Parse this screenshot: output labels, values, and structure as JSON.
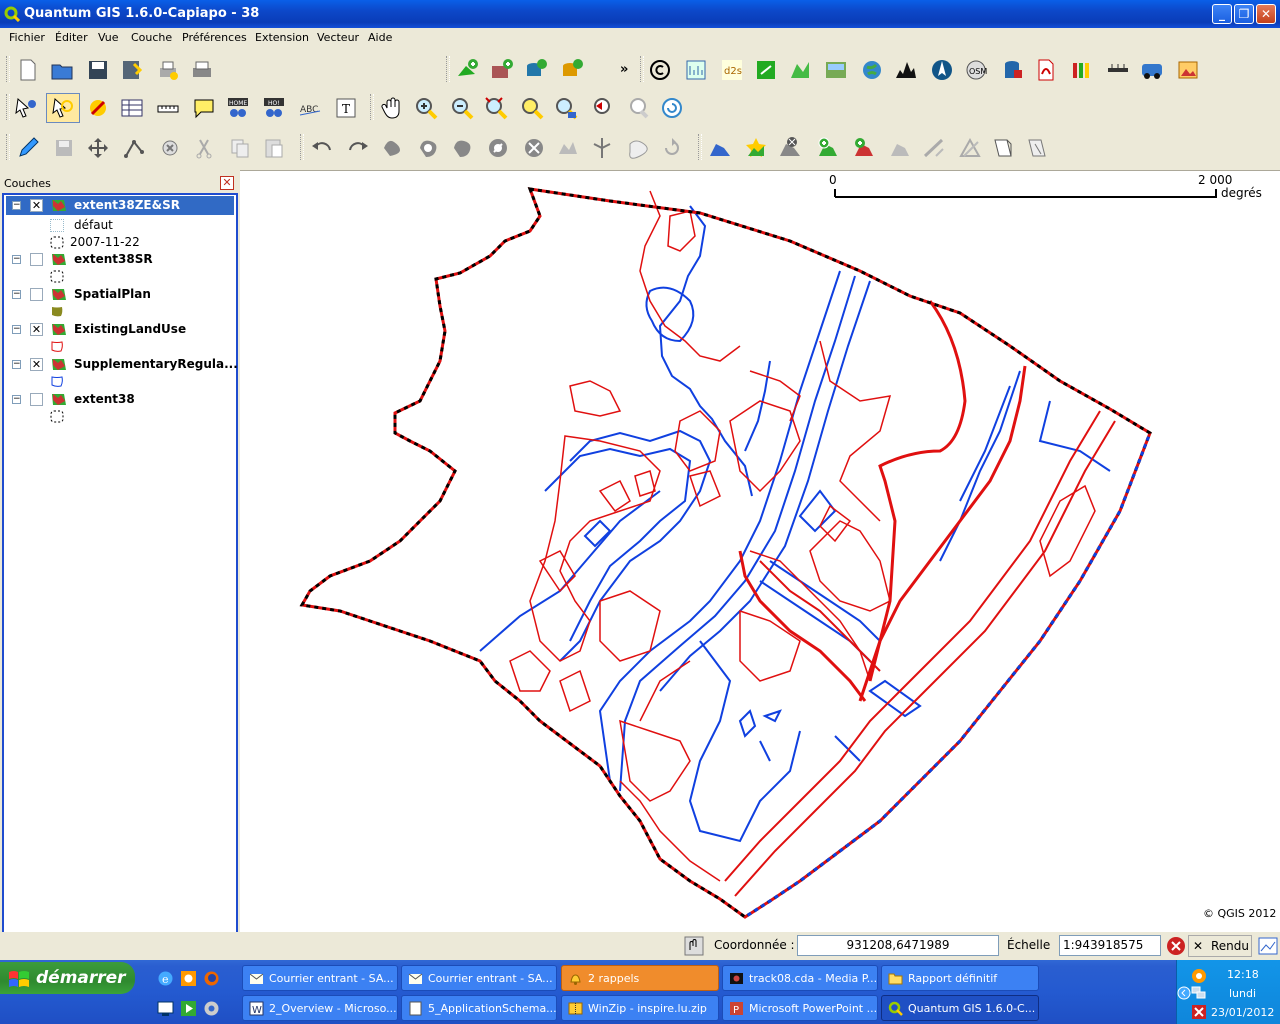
{
  "window": {
    "title": "Quantum GIS 1.6.0-Capiapo - 38",
    "buttons": {
      "minimize": "_",
      "maximize": "❐",
      "close": "✕"
    }
  },
  "menu": [
    "Fichier",
    "Éditer",
    "Vue",
    "Couche",
    "Préférences",
    "Extension",
    "Vecteur",
    "Aide"
  ],
  "toolbar": {
    "overflow_label": "»"
  },
  "legend": {
    "title": "Couches",
    "close": "✕",
    "layers": [
      {
        "name": "extent38ZE&SR",
        "checked": true,
        "selected": true,
        "expanded": true,
        "sub": [
          "défaut",
          "2007-11-22"
        ]
      },
      {
        "name": "extent38SR",
        "checked": false,
        "expanded": true
      },
      {
        "name": "SpatialPlan",
        "checked": false,
        "expanded": true
      },
      {
        "name": "ExistingLandUse",
        "checked": true,
        "expanded": true
      },
      {
        "name": "SupplementaryRegula...",
        "checked": true,
        "expanded": true
      },
      {
        "name": "extent38",
        "checked": false,
        "expanded": true
      }
    ]
  },
  "map": {
    "scalebar": {
      "start": "0",
      "end": "2 000",
      "unit": "degrés"
    },
    "copyright": "© QGIS 2012",
    "colors": {
      "red": "#e01010",
      "blue": "#1040e0",
      "boundary": "#000000"
    }
  },
  "status": {
    "coord_label": "Coordonnée :",
    "coord_value": "931208,6471989",
    "scale_label": "Échelle",
    "scale_value": "1:943918575",
    "render_label": "Rendu"
  },
  "taskbar": {
    "start_label": "démarrer",
    "row1": [
      "Courrier entrant - SA...",
      "Courrier entrant - SA...",
      "2 rappels",
      "track08.cda - Media P...",
      "Rapport définitif"
    ],
    "row2": [
      "2_Overview - Microso...",
      "5_ApplicationSchema...",
      "WinZip - inspire.lu.zip",
      "Microsoft PowerPoint ...",
      "Quantum GIS 1.6.0-C..."
    ],
    "clock": {
      "time": "12:18",
      "day": "lundi",
      "date": "23/01/2012"
    }
  }
}
